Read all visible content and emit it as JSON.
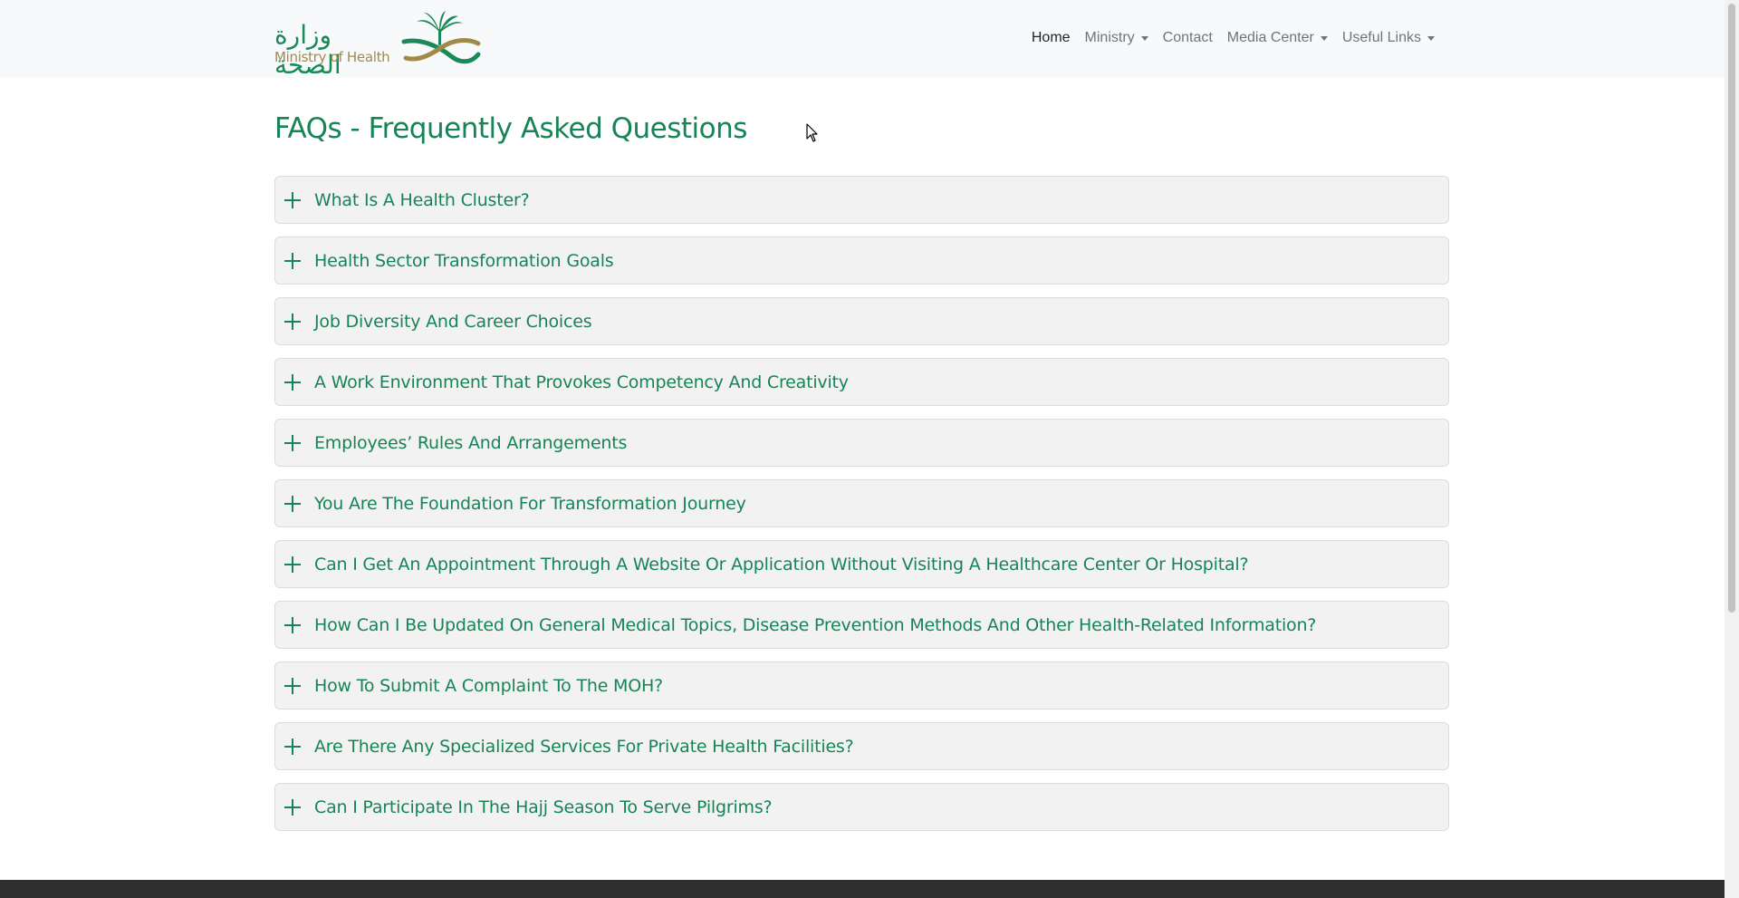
{
  "logo": {
    "arabic": "وزارة الصحة",
    "english": "Ministry of Health",
    "emblem": "palm-and-swords-emblem"
  },
  "nav": {
    "items": [
      {
        "label": "Home",
        "dropdown": false,
        "active": true
      },
      {
        "label": "Ministry",
        "dropdown": true,
        "active": false
      },
      {
        "label": "Contact",
        "dropdown": false,
        "active": false
      },
      {
        "label": "Media Center",
        "dropdown": true,
        "active": false
      },
      {
        "label": "Useful Links",
        "dropdown": true,
        "active": false
      }
    ]
  },
  "page": {
    "title": "FAQs - Frequently Asked Questions"
  },
  "faqs": [
    "What Is A Health Cluster?",
    "Health Sector Transformation Goals",
    "Job Diversity And Career Choices",
    "A Work Environment That Provokes Competency And Creativity",
    "Employees’ Rules And Arrangements",
    "You Are The Foundation For Transformation Journey",
    "Can I Get An Appointment Through A Website Or Application Without Visiting A Healthcare Center Or Hospital?",
    "How Can I Be Updated On General Medical Topics, Disease Prevention Methods And Other Health-Related Information?",
    "How To Submit A Complaint To The MOH?",
    "Are There Any Specialized Services For Private Health Facilities?",
    "Can I Participate In The Hajj Season To Serve Pilgrims?"
  ],
  "icons": {
    "expand": "plus-icon",
    "dropdown": "caret-down-icon",
    "pointer": "mouse-cursor-icon"
  },
  "colors": {
    "brand_green": "#178457",
    "brand_gold": "#a08a4a",
    "navbar_bg": "#f8f9fa",
    "faq_bg": "#f2f2f2",
    "footer_bg": "#2f2f2f"
  }
}
